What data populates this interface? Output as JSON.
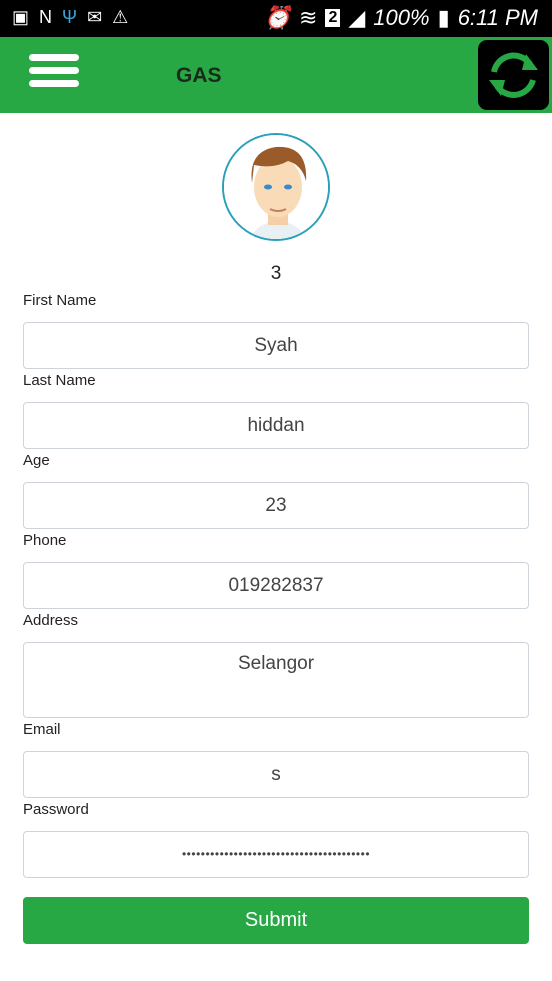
{
  "status_bar": {
    "battery": "100%",
    "time": "6:11 PM",
    "sim": "2"
  },
  "header": {
    "title": "GAS",
    "menu_icon": "hamburger-icon",
    "refresh_icon": "refresh-icon",
    "accent": "#28a745"
  },
  "profile": {
    "id": "3"
  },
  "form": {
    "first_name": {
      "label": "First Name",
      "value": "Syah"
    },
    "last_name": {
      "label": "Last Name",
      "value": "hiddan"
    },
    "age": {
      "label": "Age",
      "value": "23"
    },
    "phone": {
      "label": "Phone",
      "value": "019282837"
    },
    "address": {
      "label": "Address",
      "value": "Selangor"
    },
    "email": {
      "label": "Email",
      "value": "s"
    },
    "password": {
      "label": "Password",
      "value": "••••••••••••••••••••••••••••••••••••••••"
    },
    "submit": "Submit"
  }
}
